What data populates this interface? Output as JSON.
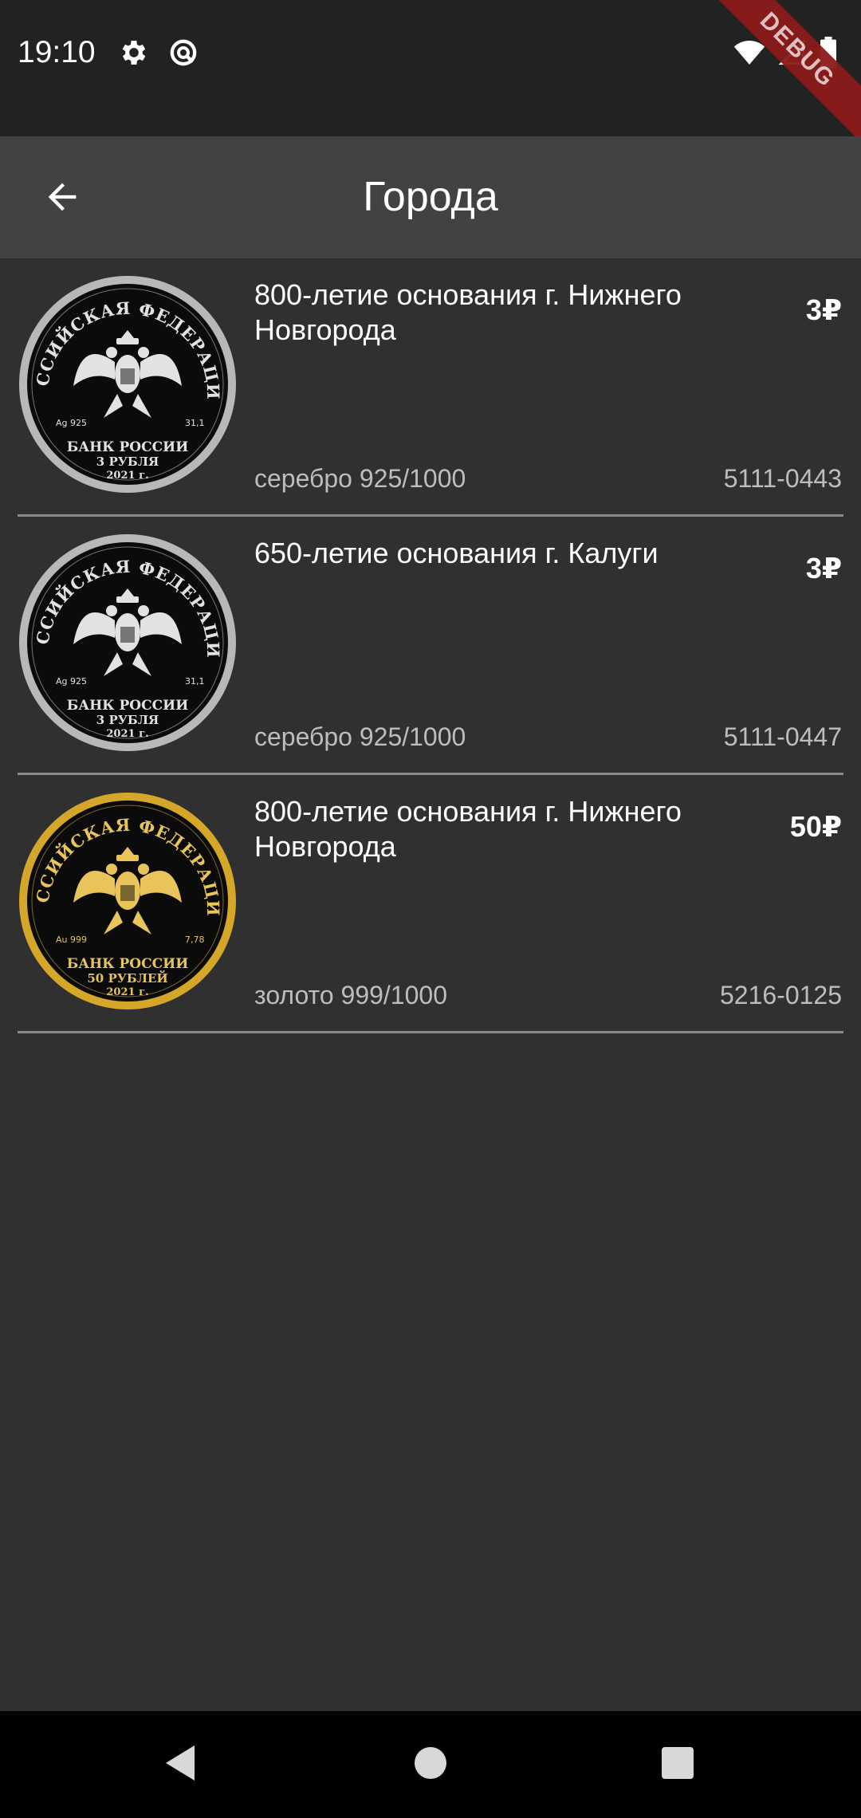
{
  "status": {
    "time": "19:10",
    "debug_label": "DEBUG"
  },
  "app_bar": {
    "title": "Города"
  },
  "coins": [
    {
      "title": "800-летие основания г. Нижнего Новгорода",
      "price": "3₽",
      "metal": "серебро 925/1000",
      "catalog": "5111-0443",
      "coin_type": "silver"
    },
    {
      "title": "650-летие основания г. Калуги",
      "price": "3₽",
      "metal": "серебро 925/1000",
      "catalog": "5111-0447",
      "coin_type": "silver"
    },
    {
      "title": "800-летие основания г. Нижнего Новгорода",
      "price": "50₽",
      "metal": "золото 999/1000",
      "catalog": "5216-0125",
      "coin_type": "gold"
    }
  ],
  "coin_text": {
    "silver": {
      "rim": "РОССИЙСКАЯ ФЕДЕРАЦИЯ",
      "bank": "БАНК РОССИИ",
      "denom": "3 РУБЛЯ",
      "year": "2021 г.",
      "assay": "Ag 925",
      "weight": "31,1"
    },
    "gold": {
      "rim": "РОССИЙСКАЯ ФЕДЕРАЦИЯ",
      "bank": "БАНК РОССИИ",
      "denom": "50 РУБЛЕЙ",
      "year": "2021 г.",
      "assay": "Au 999",
      "weight": "7,78"
    }
  },
  "colors": {
    "background": "#303030",
    "app_bar": "#424242",
    "status_bar": "#222222",
    "gold": "#d4a62a",
    "silver": "#b8b8b8"
  },
  "icons": {
    "status_left": [
      "gear-icon",
      "sync-icon"
    ],
    "status_right": [
      "wifi-icon",
      "signal-icon",
      "battery-icon"
    ],
    "back": "arrow-back-icon",
    "nav": [
      "nav-back-icon",
      "nav-home-icon",
      "nav-recents-icon"
    ]
  }
}
